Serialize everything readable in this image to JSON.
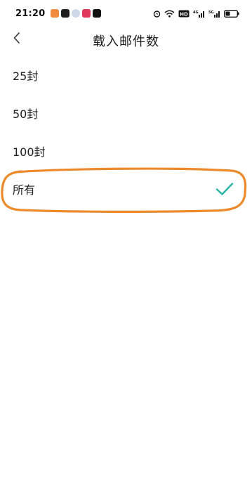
{
  "status_bar": {
    "time": "21:20",
    "app_icons": [
      {
        "name": "app-icon-photos",
        "color": "#f08a3c"
      },
      {
        "name": "app-icon-camera",
        "color": "#1c1c1c"
      },
      {
        "name": "app-icon-weather",
        "color": "#cfd8e8"
      },
      {
        "name": "app-icon-video",
        "color": "#e0375b"
      },
      {
        "name": "app-icon-tiktok",
        "color": "#111111"
      }
    ],
    "right_icons": [
      "alarm-icon",
      "wifi-icon",
      "hd-icon",
      "signal-icon-1",
      "signal-icon-2",
      "battery-icon"
    ]
  },
  "header": {
    "back_icon": "chevron-left-icon",
    "title": "载入邮件数"
  },
  "options": [
    {
      "label": "25封",
      "selected": false
    },
    {
      "label": "50封",
      "selected": false
    },
    {
      "label": "100封",
      "selected": false
    },
    {
      "label": "所有",
      "selected": true
    }
  ],
  "colors": {
    "accent_check": "#2ab3a4",
    "highlight_orange": "#ec8a2c"
  }
}
